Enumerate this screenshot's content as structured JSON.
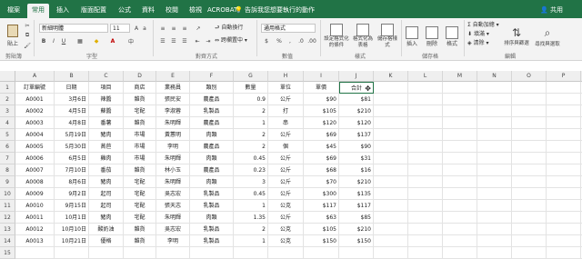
{
  "tabs": [
    "檔案",
    "常用",
    "插入",
    "版面配置",
    "公式",
    "資料",
    "校閱",
    "檢視",
    "ACROBAT"
  ],
  "tell_me": "告訴我您想要執行的動作",
  "share": "共用",
  "ribbon": {
    "paste": "貼上",
    "font_name": "新細明體",
    "font_size": "11",
    "wrap_text": "自動換行",
    "merge_center": "跨欄置中",
    "number_format": "通用格式",
    "cond_format": "設定格式化的條件",
    "format_table": "格式化為表格",
    "cell_styles": "儲存格樣式",
    "insert": "插入",
    "delete": "刪除",
    "format": "格式",
    "autosum": "自動加總",
    "fill": "填滿",
    "clear": "清除",
    "sort_filter": "排序與篩選",
    "find_select": "尋找與選取",
    "groups": [
      "剪貼簿",
      "字型",
      "對齊方式",
      "數值",
      "樣式",
      "儲存格",
      "編輯"
    ]
  },
  "columns": [
    "A",
    "B",
    "C",
    "D",
    "E",
    "F",
    "G",
    "H",
    "I",
    "J",
    "K",
    "L",
    "M",
    "N",
    "O",
    "P",
    "Q"
  ],
  "header": [
    "訂單編號",
    "日期",
    "項目",
    "商店",
    "業務員",
    "類別",
    "數量",
    "單位",
    "單價",
    "合計"
  ],
  "rows": [
    [
      "A0001",
      "3月6日",
      "辣醬",
      "雜貨",
      "張民安",
      "農產品",
      "0.9",
      "公斤",
      "$90",
      "$81"
    ],
    [
      "A0002",
      "4月5日",
      "蘇醬",
      "宅配",
      "李淑蓉",
      "乳製品",
      "2",
      "打",
      "$105",
      "$210"
    ],
    [
      "A0003",
      "4月8日",
      "番薯",
      "雜貨",
      "朱明輝",
      "農產品",
      "1",
      "串",
      "$120",
      "$120"
    ],
    [
      "A0004",
      "5月19日",
      "豬肉",
      "市場",
      "黃蕙明",
      "肉類",
      "2",
      "公斤",
      "$69",
      "$137"
    ],
    [
      "A0005",
      "5月30日",
      "萵苣",
      "市場",
      "李明",
      "農產品",
      "2",
      "個",
      "$45",
      "$90"
    ],
    [
      "A0006",
      "6月5日",
      "雞肉",
      "市場",
      "朱明輝",
      "肉類",
      "0.45",
      "公斤",
      "$69",
      "$31"
    ],
    [
      "A0007",
      "7月10日",
      "番茄",
      "雜貨",
      "林小玉",
      "農產品",
      "0.23",
      "公斤",
      "$68",
      "$16"
    ],
    [
      "A0008",
      "8月6日",
      "豬肉",
      "宅配",
      "朱明輝",
      "肉類",
      "3",
      "公斤",
      "$70",
      "$210"
    ],
    [
      "A0009",
      "9月2日",
      "起司",
      "宅配",
      "吳志宏",
      "乳製品",
      "0.45",
      "公斤",
      "$300",
      "$135"
    ],
    [
      "A0010",
      "9月15日",
      "起司",
      "宅配",
      "張天志",
      "乳製品",
      "1",
      "公克",
      "$117",
      "$117"
    ],
    [
      "A0011",
      "10月1日",
      "豬肉",
      "宅配",
      "朱明輝",
      "肉類",
      "1.35",
      "公斤",
      "$63",
      "$85"
    ],
    [
      "A0012",
      "10月10日",
      "酸奶油",
      "雜貨",
      "吳志宏",
      "乳製品",
      "2",
      "公克",
      "$105",
      "$210"
    ],
    [
      "A0013",
      "10月21日",
      "優格",
      "雜貨",
      "李明",
      "乳製品",
      "1",
      "公克",
      "$150",
      "$150"
    ]
  ],
  "row_numbers": [
    "1",
    "2",
    "3",
    "4",
    "5",
    "6",
    "7",
    "8",
    "9",
    "10",
    "11",
    "12",
    "13",
    "14",
    "15"
  ]
}
